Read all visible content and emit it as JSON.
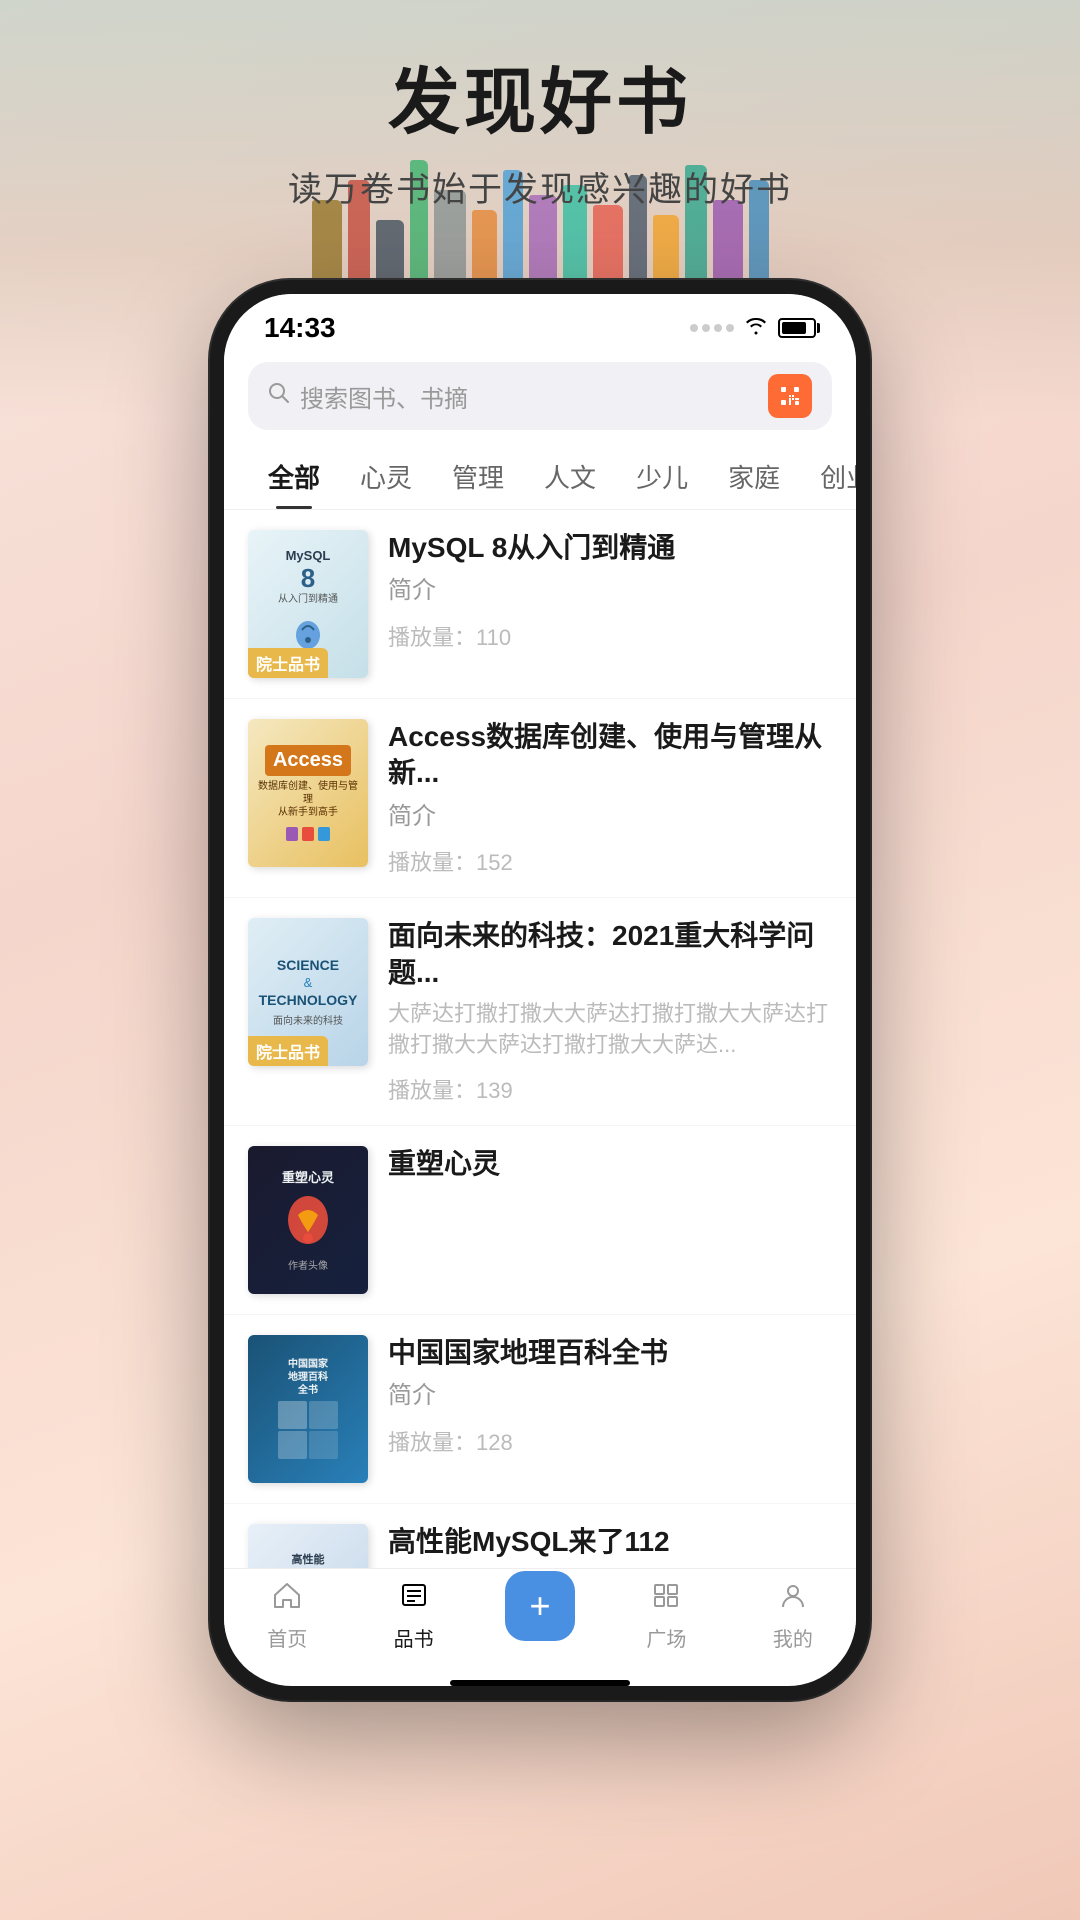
{
  "hero": {
    "title": "发现好书",
    "subtitle": "读万卷书始于发现感兴趣的好书"
  },
  "status_bar": {
    "time": "14:33"
  },
  "search": {
    "placeholder": "搜索图书、书摘"
  },
  "categories": [
    {
      "id": "all",
      "label": "全部",
      "active": true
    },
    {
      "id": "mind",
      "label": "心灵",
      "active": false
    },
    {
      "id": "manage",
      "label": "管理",
      "active": false
    },
    {
      "id": "culture",
      "label": "人文",
      "active": false
    },
    {
      "id": "children",
      "label": "少儿",
      "active": false
    },
    {
      "id": "family",
      "label": "家庭",
      "active": false
    },
    {
      "id": "startup",
      "label": "创业",
      "active": false
    }
  ],
  "books": [
    {
      "title": "MySQL 8从入门到精通",
      "desc": "简介",
      "plays": "播放量：110",
      "badge": "院士品书",
      "cover_type": "mysql"
    },
    {
      "title": "Access数据库创建、使用与管理从新...",
      "desc": "简介",
      "plays": "播放量：152",
      "badge": null,
      "cover_type": "access"
    },
    {
      "title": "面向未来的科技：2021重大科学问题...",
      "desc": "大萨达打撒打撒大大萨达打撒打撒大大萨达打撒打撒大大萨达打撒打撒大大萨达...",
      "plays": "播放量：139",
      "badge": "院士品书",
      "cover_type": "science"
    },
    {
      "title": "重塑心灵",
      "desc": "",
      "plays": "",
      "badge": null,
      "cover_type": "soul"
    },
    {
      "title": "中国国家地理百科全书",
      "desc": "简介",
      "plays": "播放量：128",
      "badge": null,
      "cover_type": "geo"
    },
    {
      "title": "高性能MySQL来了112",
      "desc": "",
      "plays": "",
      "badge": null,
      "cover_type": "highperf"
    }
  ],
  "bottom_nav": [
    {
      "id": "home",
      "label": "首页",
      "icon": "⌂",
      "active": false
    },
    {
      "id": "books",
      "label": "品书",
      "icon": "☰",
      "active": true
    },
    {
      "id": "add",
      "label": "",
      "icon": "+",
      "active": false,
      "special": true
    },
    {
      "id": "plaza",
      "label": "广场",
      "icon": "□",
      "active": false
    },
    {
      "id": "mine",
      "label": "我的",
      "icon": "◯",
      "active": false
    }
  ]
}
